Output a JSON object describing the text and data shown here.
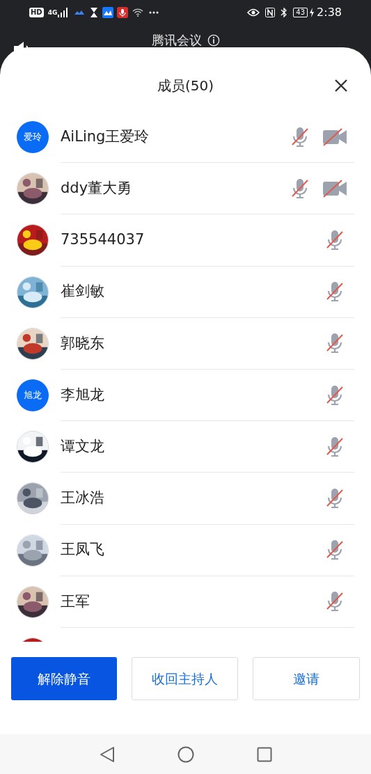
{
  "status_bar": {
    "badge": "HD",
    "network": "4G",
    "battery": "43",
    "time": "2:38"
  },
  "header": {
    "title": "腾讯会议"
  },
  "panel": {
    "title": "成员(50)",
    "members": [
      {
        "name": "AiLing王爱玲",
        "avatar": {
          "kind": "initials",
          "text": "爱玲"
        },
        "muted": true,
        "video_off": true
      },
      {
        "name": "ddy董大勇",
        "avatar": {
          "kind": "picture"
        },
        "muted": true,
        "video_off": true
      },
      {
        "name": "735544037",
        "avatar": {
          "kind": "picture"
        },
        "muted": true,
        "video_off": false
      },
      {
        "name": "崔剑敏",
        "avatar": {
          "kind": "picture"
        },
        "muted": true,
        "video_off": false
      },
      {
        "name": "郭晓东",
        "avatar": {
          "kind": "picture"
        },
        "muted": true,
        "video_off": false
      },
      {
        "name": "李旭龙",
        "avatar": {
          "kind": "initials",
          "text": "旭龙"
        },
        "muted": true,
        "video_off": false
      },
      {
        "name": "谭文龙",
        "avatar": {
          "kind": "picture"
        },
        "muted": true,
        "video_off": false
      },
      {
        "name": "王冰浩",
        "avatar": {
          "kind": "picture"
        },
        "muted": true,
        "video_off": false
      },
      {
        "name": "王凤飞",
        "avatar": {
          "kind": "picture"
        },
        "muted": true,
        "video_off": false
      },
      {
        "name": "王军",
        "avatar": {
          "kind": "picture"
        },
        "muted": true,
        "video_off": false
      },
      {
        "avatar": {
          "kind": "picture"
        }
      }
    ]
  },
  "buttons": [
    {
      "label": "解除静音",
      "primary": true
    },
    {
      "label": "收回主持人",
      "primary": false
    },
    {
      "label": "邀请",
      "primary": false
    }
  ]
}
